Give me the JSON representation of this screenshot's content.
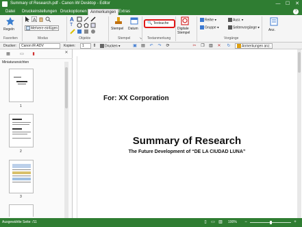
{
  "window": {
    "title": "Summary of Research.pdf - Canon iW Desktop - Editor",
    "minimize": "—",
    "maximize": "☐",
    "close": "✕"
  },
  "tabs": [
    {
      "label": "Datei"
    },
    {
      "label": "Druckeinstellungen"
    },
    {
      "label": "Druckoptionen"
    },
    {
      "label": "Anmerkungen"
    },
    {
      "label": "Extras"
    }
  ],
  "ribbon": {
    "register_label": "Regeln",
    "multi_paste_label": "Mehrere einfügen",
    "stamp_label": "Stempel",
    "date_label": "Datum",
    "text_search_label": "Textsuche",
    "digital_stamp_label": "Digitale Stempel",
    "row_label": "Reihe",
    "group_label": "Gruppe",
    "align_label": "Ausr.",
    "page_ops_label": "Seitenvorgänge",
    "show_label": "Anz.",
    "groups": {
      "favorites": "Favoriten",
      "mode": "Modus",
      "objects": "Objekte",
      "stamps": "Stempel",
      "text_annotation": "Textanmerkung",
      "operations": "Vorgänge"
    }
  },
  "printbar": {
    "printer_label": "Drucker:",
    "printer_value": "Canon iR-ADV",
    "copies_label": "Kopien:",
    "copies_value": "1",
    "print_label": "Drucken",
    "annotations_label": "Anmerkungen anz."
  },
  "sidebar": {
    "title": "Miniaturansichten",
    "pages": [
      "1",
      "2",
      "3"
    ]
  },
  "document": {
    "for_line": "For: XX Corporation",
    "title": "Summary of Research",
    "subtitle": "The Future Development of “DE LA CIUDAD LUNA”"
  },
  "status": {
    "left": "Ausgewählte Seite: /11",
    "zoom": "100%",
    "zoom_level": 0.5
  }
}
